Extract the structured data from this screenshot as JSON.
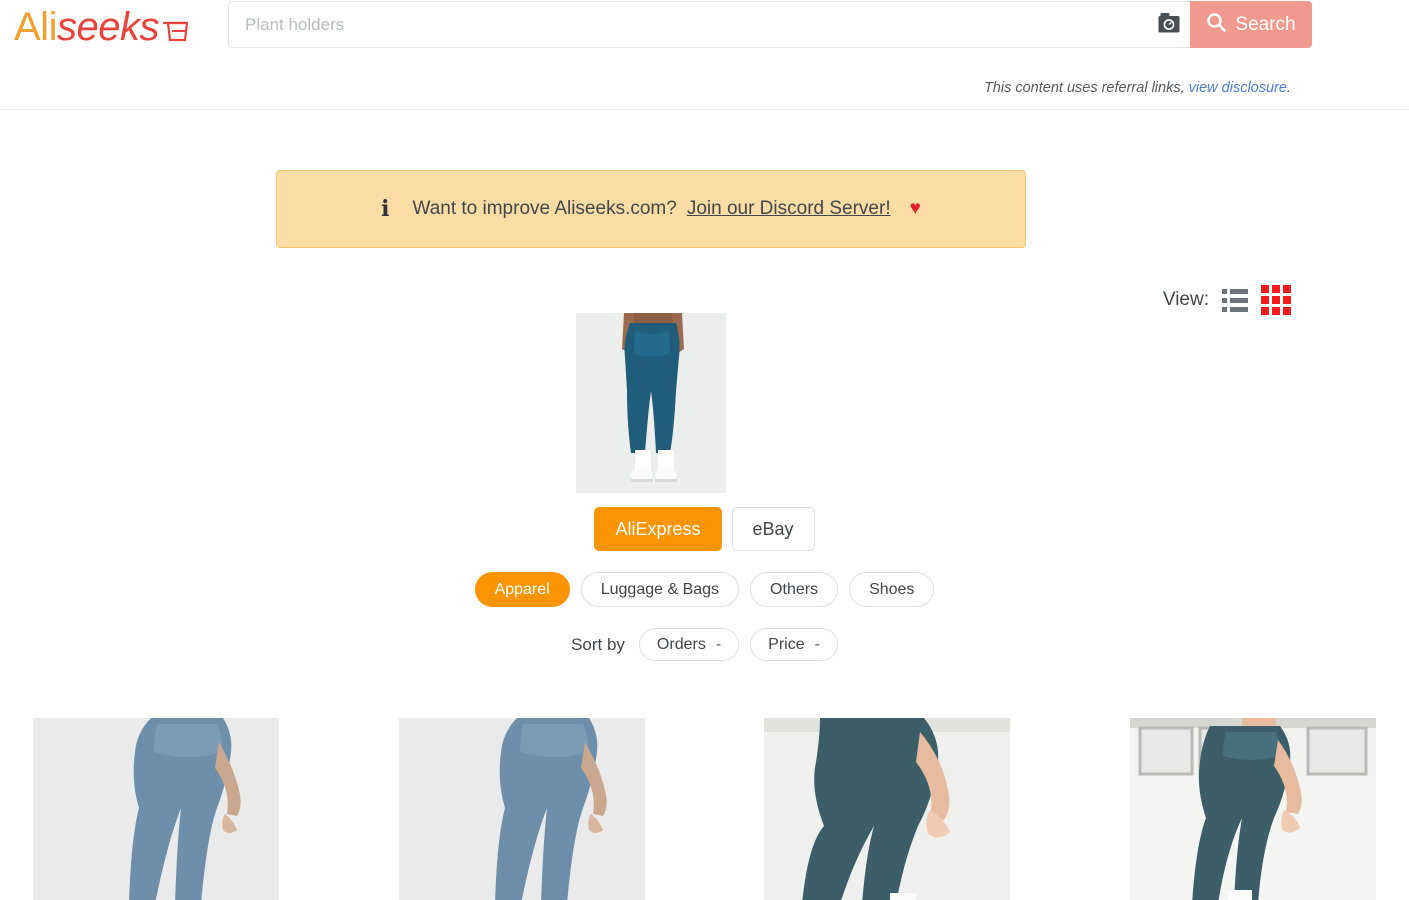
{
  "header": {
    "logo": {
      "part1": "Ali",
      "part2": "seeks",
      "cart_icon": "shopping-basket-icon"
    },
    "search": {
      "placeholder": "Plant holders",
      "value": "",
      "camera_icon": "camera-icon",
      "search_icon": "magnifier-icon",
      "button_label": "Search"
    },
    "disclosure": {
      "text": "This content uses referral links, ",
      "link": "view disclosure",
      "suffix": "."
    }
  },
  "banner": {
    "info_icon": "info-icon",
    "text": "Want to improve Aliseeks.com? ",
    "link": "Join our Discord Server!",
    "heart_icon": "heart-icon",
    "heart": "♥",
    "bg_color": "#fadca4",
    "border_color": "#f7c873"
  },
  "view": {
    "label": "View:",
    "list_icon": "list-view-icon",
    "grid_icon": "grid-view-icon",
    "active": "grid",
    "active_color": "#f41c1c",
    "inactive_color": "#6d7378"
  },
  "query_image": {
    "alt": "woman wearing teal blue leggings with white sneakers"
  },
  "marketplaces": [
    {
      "label": "AliExpress",
      "active": true
    },
    {
      "label": "eBay",
      "active": false
    }
  ],
  "categories": [
    {
      "label": "Apparel",
      "active": true
    },
    {
      "label": "Luggage & Bags",
      "active": false
    },
    {
      "label": "Others",
      "active": false
    },
    {
      "label": "Shoes",
      "active": false
    }
  ],
  "sort": {
    "label": "Sort by",
    "options": [
      {
        "label": "Orders",
        "direction": "-"
      },
      {
        "label": "Price",
        "direction": "-"
      }
    ]
  },
  "results": [
    {
      "alt": "blue-gray high waist leggings side view on light background"
    },
    {
      "alt": "blue-gray high waist leggings side view on light background"
    },
    {
      "alt": "dark teal leggings against white wall"
    },
    {
      "alt": "dark teal leggings in front of white window frame"
    }
  ],
  "colors": {
    "accent_orange": "#fc9403",
    "logo_orange": "#f0a030",
    "logo_red": "#e8433c",
    "search_button": "#f0998f",
    "link_blue": "#4a7fd4"
  }
}
